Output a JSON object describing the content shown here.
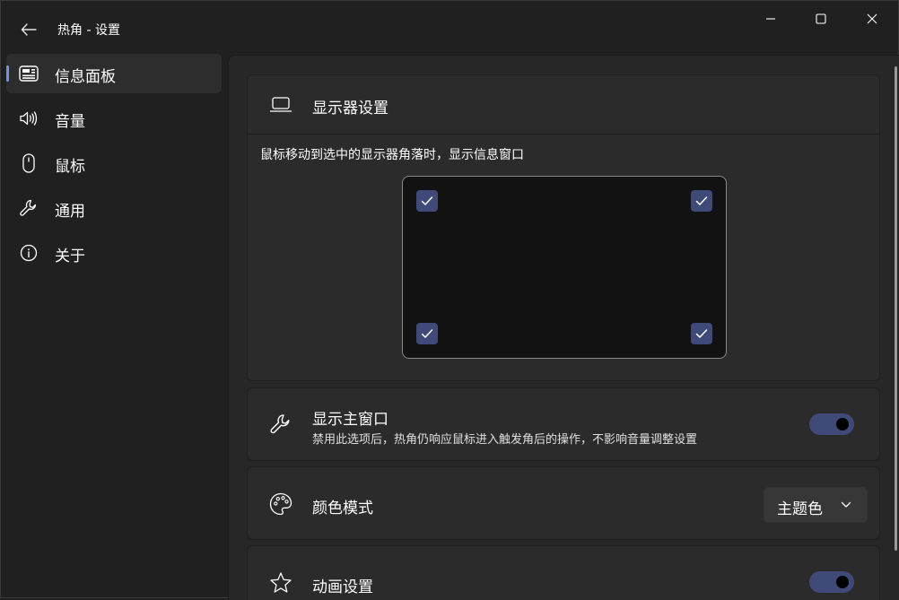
{
  "window": {
    "title": "热角 - 设置"
  },
  "sidebar": {
    "items": [
      {
        "label": "信息面板",
        "icon": "dashboard-icon",
        "active": true
      },
      {
        "label": "音量",
        "icon": "speaker-icon",
        "active": false
      },
      {
        "label": "鼠标",
        "icon": "mouse-icon",
        "active": false
      },
      {
        "label": "通用",
        "icon": "wrench-icon",
        "active": false
      },
      {
        "label": "关于",
        "icon": "info-icon",
        "active": false
      }
    ]
  },
  "display_settings": {
    "title": "显示器设置",
    "description": "鼠标移动到选中的显示器角落时，显示信息窗口",
    "corners": {
      "top_left": true,
      "top_right": true,
      "bottom_left": true,
      "bottom_right": true
    }
  },
  "show_main_window": {
    "title": "显示主窗口",
    "description": "禁用此选项后，热角仍响应鼠标进入触发角后的操作，不影响音量调整设置",
    "enabled": true
  },
  "color_mode": {
    "title": "颜色模式",
    "selected": "主题色"
  },
  "animation": {
    "title": "动画设置",
    "enabled": true
  },
  "colors": {
    "accent": "#3f4a79",
    "indicator": "#7a8fe0",
    "background": "#202020",
    "card": "#2b2b2b"
  }
}
